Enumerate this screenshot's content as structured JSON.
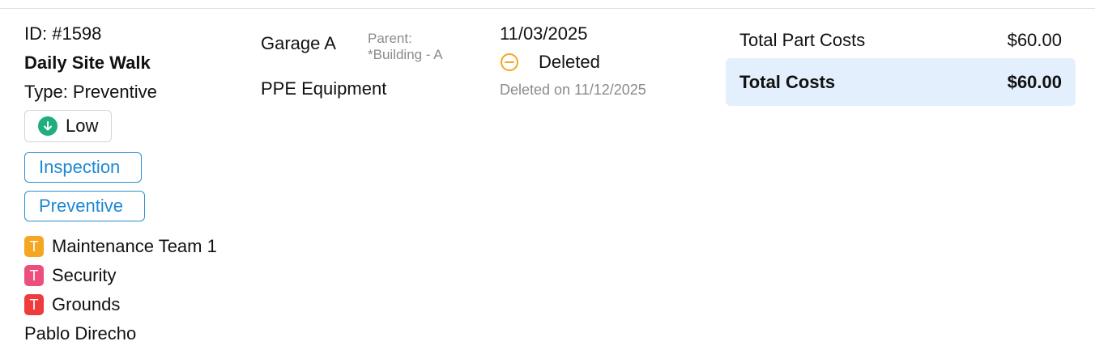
{
  "work_order": {
    "id": "ID: #1598",
    "title": "Daily Site Walk",
    "type": "Type: Preventive",
    "priority": {
      "label": "Low",
      "icon": "arrow-down-circle-icon",
      "color": "#1fae7e"
    },
    "categories": [
      "Inspection",
      "Preventive"
    ],
    "teams": [
      {
        "badge": "T",
        "name": "Maintenance Team 1",
        "color": "#f5a623"
      },
      {
        "badge": "T",
        "name": "Security",
        "color": "#ec4f7d"
      },
      {
        "badge": "T",
        "name": "Grounds",
        "color": "#ee3b3b"
      }
    ],
    "assignee": "Pablo Direcho"
  },
  "location": {
    "name": "Garage A",
    "parent_label": "Parent:",
    "parent_value": "*Building - A",
    "asset": "PPE Equipment"
  },
  "status": {
    "date": "11/03/2025",
    "label": "Deleted",
    "icon": "minus-circle-icon",
    "color": "#f5a623",
    "deleted_on": "Deleted on 11/12/2025"
  },
  "costs": {
    "part_label": "Total Part Costs",
    "part_value": "$60.00",
    "total_label": "Total Costs",
    "total_value": "$60.00"
  }
}
